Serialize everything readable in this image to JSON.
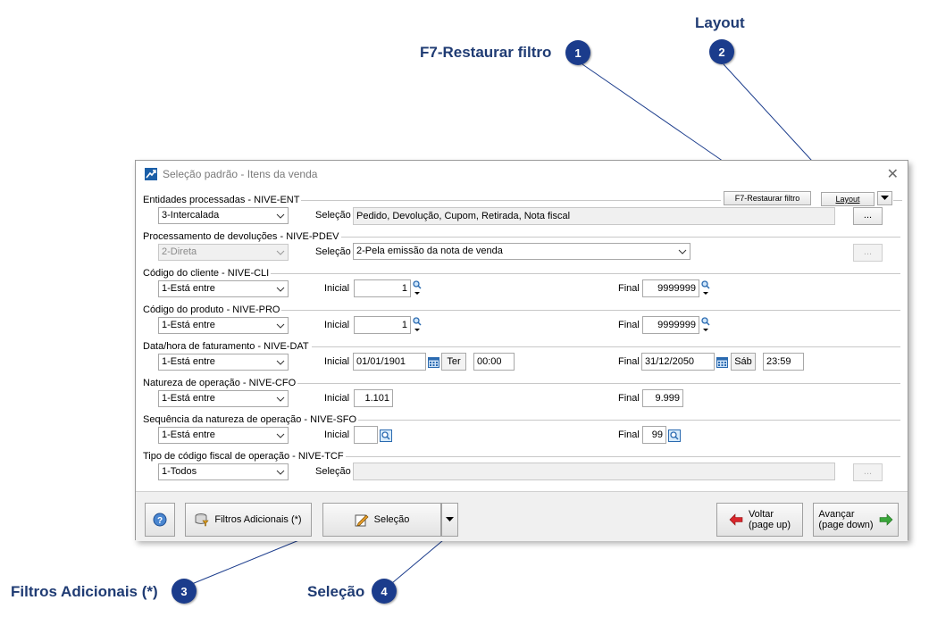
{
  "callouts": [
    {
      "text": "F7-Restaurar filtro",
      "num": "1"
    },
    {
      "text": "Layout",
      "num": "2"
    },
    {
      "text": "Filtros Adicionais (*)",
      "num": "3"
    },
    {
      "text": "Seleção",
      "num": "4"
    }
  ],
  "window": {
    "title": "Seleção padrão - Itens da venda",
    "close": "✕"
  },
  "toolbar": {
    "restore_filter": "F7-Restaurar filtro",
    "layout": "Layout"
  },
  "sections": {
    "ent": {
      "label": "Entidades processadas - NIVE-ENT",
      "combo": "3-Intercalada",
      "sel_label": "Seleção",
      "sel_value": "Pedido, Devolução, Cupom, Retirada, Nota fiscal",
      "dots": "..."
    },
    "pdev": {
      "label": "Processamento de devoluções - NIVE-PDEV",
      "combo": "2-Direta",
      "sel_label": "Seleção",
      "sel_value": "2-Pela emissão da nota de venda",
      "dots": "..."
    },
    "cli": {
      "label": "Código do cliente - NIVE-CLI",
      "combo": "1-Está entre",
      "ini_label": "Inicial",
      "ini_value": "1",
      "fin_label": "Final",
      "fin_value": "9999999"
    },
    "pro": {
      "label": "Código do produto - NIVE-PRO",
      "combo": "1-Está entre",
      "ini_label": "Inicial",
      "ini_value": "1",
      "fin_label": "Final",
      "fin_value": "9999999"
    },
    "dat": {
      "label": "Data/hora de faturamento - NIVE-DAT",
      "combo": "1-Está entre",
      "ini_label": "Inicial",
      "ini_date": "01/01/1901",
      "ini_day": "Ter",
      "ini_time": "00:00",
      "fin_label": "Final",
      "fin_date": "31/12/2050",
      "fin_day": "Sáb",
      "fin_time": "23:59"
    },
    "cfo": {
      "label": "Natureza de operação - NIVE-CFO",
      "combo": "1-Está entre",
      "ini_label": "Inicial",
      "ini_value": "1.101",
      "fin_label": "Final",
      "fin_value": "9.999"
    },
    "sfo": {
      "label": "Sequência da natureza de operação - NIVE-SFO",
      "combo": "1-Está entre",
      "ini_label": "Inicial",
      "ini_value": "",
      "fin_label": "Final",
      "fin_value": "99"
    },
    "tcf": {
      "label": "Tipo de código fiscal de operação - NIVE-TCF",
      "combo": "1-Todos",
      "sel_label": "Seleção",
      "sel_value": "",
      "dots": "..."
    }
  },
  "bottom": {
    "filtros": "Filtros Adicionais (*)",
    "selecao": "Seleção",
    "voltar_1": "Voltar",
    "voltar_2": "(page up)",
    "avancar_1": "Avançar",
    "avancar_2": "(page down)"
  },
  "colors": {
    "callout_badge": "#1b3c8c",
    "callout_text": "#1f3b73",
    "voltar_arrow": "#d9262c",
    "avancar_arrow": "#3aa63a"
  }
}
